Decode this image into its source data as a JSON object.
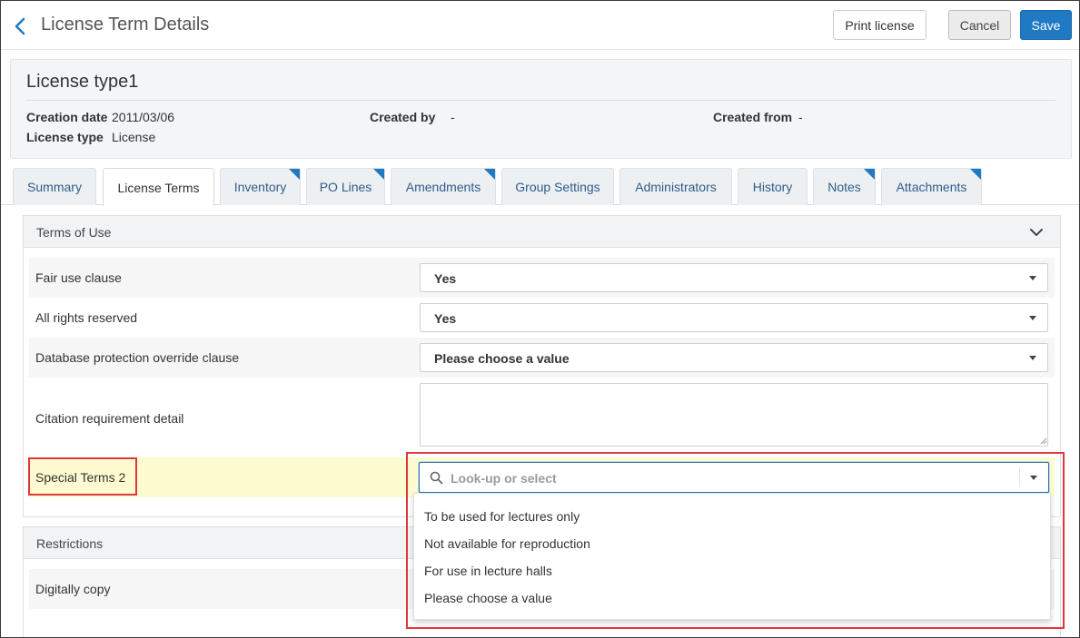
{
  "header": {
    "title": "License Term Details",
    "print_label": "Print license",
    "cancel_label": "Cancel",
    "save_label": "Save"
  },
  "record": {
    "title": "License type1",
    "creation_date_label": "Creation date",
    "creation_date_value": "2011/03/06",
    "created_by_label": "Created by",
    "created_by_value": "-",
    "created_from_label": "Created from",
    "created_from_value": "-",
    "license_type_label": "License type",
    "license_type_value": "License"
  },
  "tabs": [
    {
      "label": "Summary",
      "active": false,
      "flag": false
    },
    {
      "label": "License Terms",
      "active": true,
      "flag": false
    },
    {
      "label": "Inventory",
      "active": false,
      "flag": true
    },
    {
      "label": "PO Lines",
      "active": false,
      "flag": true
    },
    {
      "label": "Amendments",
      "active": false,
      "flag": true
    },
    {
      "label": "Group Settings",
      "active": false,
      "flag": false
    },
    {
      "label": "Administrators",
      "active": false,
      "flag": false
    },
    {
      "label": "History",
      "active": false,
      "flag": false
    },
    {
      "label": "Notes",
      "active": false,
      "flag": true
    },
    {
      "label": "Attachments",
      "active": false,
      "flag": true
    }
  ],
  "terms_of_use": {
    "title": "Terms of Use",
    "rows": [
      {
        "label": "Fair use clause",
        "value": "Yes"
      },
      {
        "label": "All rights reserved",
        "value": "Yes"
      },
      {
        "label": "Database protection override clause",
        "value": "Please choose a value"
      },
      {
        "label": "Citation requirement detail",
        "value": ""
      }
    ],
    "special_terms": {
      "label": "Special Terms 2",
      "placeholder": "Look-up or select",
      "options": [
        "To be used for lectures only",
        "Not available for reproduction",
        "For use in lecture halls",
        "Please choose a value"
      ]
    }
  },
  "restrictions": {
    "title": "Restrictions",
    "rows": [
      {
        "label": "Digitally copy"
      }
    ]
  },
  "colors": {
    "accent": "#1f7ac3",
    "highlight": "#fdfbcf",
    "callout": "#e0383b"
  }
}
